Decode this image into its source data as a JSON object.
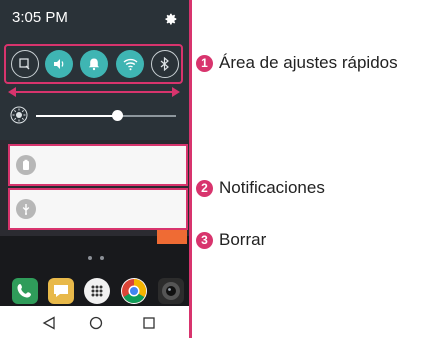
{
  "status_bar": {
    "time": "3:05 PM",
    "settings_icon": "gear-icon"
  },
  "quick_settings": {
    "toggles": [
      {
        "name": "qslide",
        "icon": "qslide-icon",
        "active": false
      },
      {
        "name": "sound",
        "icon": "sound-icon",
        "active": true
      },
      {
        "name": "notifications",
        "icon": "bell-icon",
        "active": true
      },
      {
        "name": "wifi",
        "icon": "wifi-icon",
        "active": true
      },
      {
        "name": "bluetooth",
        "icon": "bluetooth-icon",
        "active": false
      }
    ],
    "brightness_level": 0.58
  },
  "notifications": [
    {
      "icon": "battery-icon"
    },
    {
      "icon": "usb-icon"
    }
  ],
  "callouts": [
    {
      "number": "1",
      "label": "Área de ajustes rápidos"
    },
    {
      "number": "2",
      "label": "Notificaciones"
    },
    {
      "number": "3",
      "label": "Borrar"
    }
  ],
  "dock": [
    "phone-icon",
    "messages-icon",
    "apps-icon",
    "chrome-icon",
    "camera-icon"
  ],
  "nav": [
    "back-icon",
    "home-icon",
    "recents-icon"
  ],
  "colors": {
    "accent": "#d8346d",
    "toggle_on": "#3fb5b3",
    "clear_button": "#ef6b34"
  }
}
